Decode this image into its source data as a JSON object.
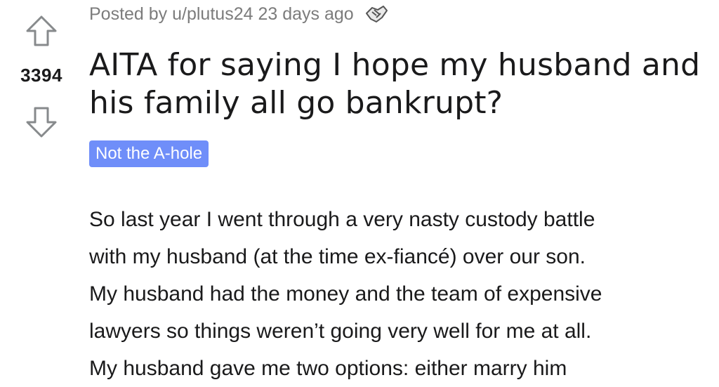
{
  "post": {
    "score": "3394",
    "meta": "Posted by u/plutus24 23 days ago",
    "title": "AITA for saying I hope my husband and his family all go bankrupt?",
    "flair": "Not the A-hole",
    "body_lines": [
      "So last year I went through a very nasty custody battle",
      "with my husband (at the time ex-fiancé) over our son.",
      "My husband had the money and the team of expensive",
      "lawyers so things weren’t going very well for me at all.",
      "My husband gave me two options: either marry him"
    ]
  },
  "icons": {
    "upvote": "arrow-up-icon",
    "downvote": "arrow-down-icon",
    "award": "handshake-award-icon"
  },
  "colors": {
    "flair_bg": "#6f8ef9",
    "meta_text": "#7c7c7c",
    "arrow_stroke": "#878a8c"
  }
}
